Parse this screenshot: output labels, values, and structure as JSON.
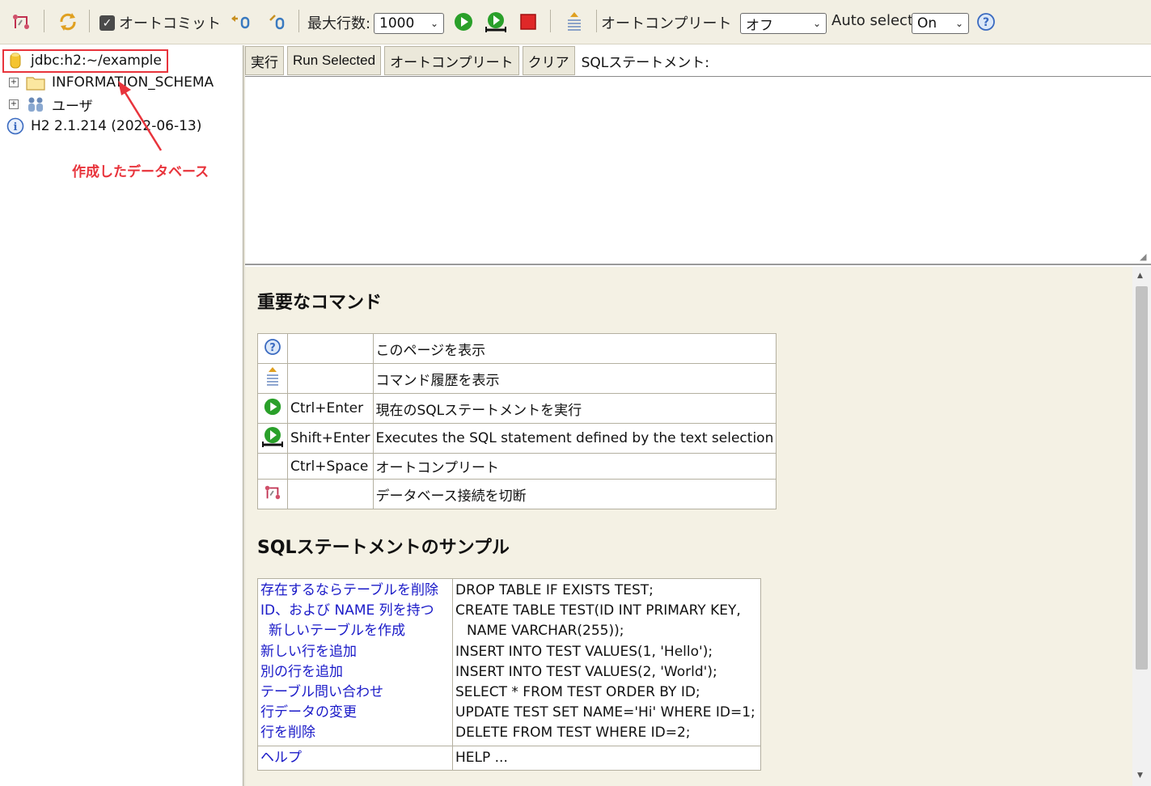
{
  "toolbar": {
    "autocommit_label": "オートコミット",
    "max_rows_label": "最大行数:",
    "max_rows_value": "1000",
    "autocomplete_label": "オートコンプリート",
    "autocomplete_value": "オフ",
    "auto_select_label": "Auto select",
    "auto_select_value": "On",
    "autocommit_checked": true
  },
  "tree": {
    "connection": "jdbc:h2:~/example",
    "items": [
      {
        "label": "INFORMATION_SCHEMA",
        "icon": "folder-icon"
      },
      {
        "label": "ユーザ",
        "icon": "users-icon"
      }
    ],
    "version": "H2 2.1.214 (2022-06-13)",
    "annotation": "作成したデータベース",
    "annotation_color": "#e8343c"
  },
  "query_bar": {
    "run": "実行",
    "run_selected": "Run Selected",
    "autocomplete": "オートコンプリート",
    "clear": "クリア",
    "sql_label": "SQLステートメント:"
  },
  "sql": {
    "value": ""
  },
  "help": {
    "commands_title": "重要なコマンド",
    "commands": [
      {
        "icon": "help-icon",
        "key": "",
        "desc": "このページを表示"
      },
      {
        "icon": "history-icon",
        "key": "",
        "desc": "コマンド履歴を表示"
      },
      {
        "icon": "run-icon",
        "key": "Ctrl+Enter",
        "desc": "現在のSQLステートメントを実行"
      },
      {
        "icon": "run-selected-icon",
        "key": "Shift+Enter",
        "desc": "Executes the SQL statement defined by the text selection"
      },
      {
        "icon": "",
        "key": "Ctrl+Space",
        "desc": "オートコンプリート"
      },
      {
        "icon": "disconnect-icon",
        "key": "",
        "desc": "データベース接続を切断"
      }
    ],
    "samples_title": "SQLステートメントのサンプル",
    "samples": {
      "links": [
        "存在するならテーブルを削除",
        "ID、および NAME 列を持つ",
        "新しいテーブルを作成",
        "新しい行を追加",
        "別の行を追加",
        "テーブル問い合わせ",
        "行データの変更",
        "行を削除"
      ],
      "sql": [
        "DROP TABLE IF EXISTS TEST;",
        "CREATE TABLE TEST(ID INT PRIMARY KEY,",
        "NAME VARCHAR(255));",
        "INSERT INTO TEST VALUES(1, 'Hello');",
        "INSERT INTO TEST VALUES(2, 'World');",
        "SELECT * FROM TEST ORDER BY ID;",
        "UPDATE TEST SET NAME='Hi' WHERE ID=1;",
        "DELETE FROM TEST WHERE ID=2;"
      ],
      "help_link": "ヘルプ",
      "help_sql": "HELP ..."
    }
  },
  "colors": {
    "toolbar_bg": "#f2efe3",
    "panel_bg": "#f4f1e4",
    "link": "#1a1ac8",
    "run_green": "#2aa02a",
    "stop_red": "#e02828"
  }
}
